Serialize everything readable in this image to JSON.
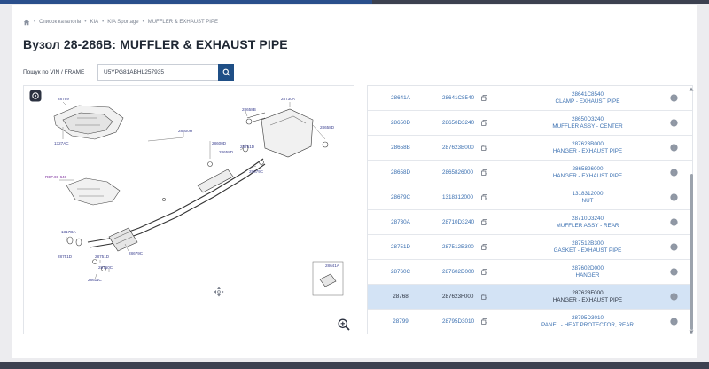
{
  "breadcrumb": {
    "items": [
      "Список каталогів",
      "KIA",
      "KIA Sportage",
      "MUFFLER & EXHAUST PIPE"
    ]
  },
  "page": {
    "title": "Вузол 28-286B: MUFFLER & EXHAUST PIPE"
  },
  "search": {
    "label": "Пошук по VIN / FRAME",
    "value": "U5YPG81ABHL257935"
  },
  "diagram": {
    "labels": {
      "l28799": "28799",
      "l1327AC": "1327AC",
      "l28600H": "28600H",
      "l28730A": "28730A",
      "l28658B": "28658B",
      "l28658D": "28658D",
      "l28600D": "28600D",
      "l28658D_2": "28658D",
      "l28751D_top": "28751D",
      "l28679C": "28679C",
      "lREF": "REF.69-640",
      "l1317DA": "1317DA",
      "l28751D_low": "28751D",
      "l28751D_mid": "28751D",
      "l28760C": "28760C",
      "l28679C_low": "28679C",
      "l28611C": "28611C",
      "l28641A": "28641A"
    }
  },
  "parts": {
    "rows": [
      {
        "ref": "28641A",
        "part": "28641C8540",
        "number": "28641C8540",
        "name": "CLAMP - EXHAUST PIPE",
        "selected": false
      },
      {
        "ref": "28650D",
        "part": "28650D3240",
        "number": "28650D3240",
        "name": "MUFFLER ASSY - CENTER",
        "selected": false
      },
      {
        "ref": "28658B",
        "part": "287623B000",
        "number": "287623B000",
        "name": "HANGER - EXHAUST PIPE",
        "selected": false
      },
      {
        "ref": "28658D",
        "part": "2865826000",
        "number": "2865826000",
        "name": "HANGER - EXHAUST PIPE",
        "selected": false
      },
      {
        "ref": "28679C",
        "part": "1318312000",
        "number": "1318312000",
        "name": "NUT",
        "selected": false
      },
      {
        "ref": "28730A",
        "part": "28710D3240",
        "number": "28710D3240",
        "name": "MUFFLER ASSY - REAR",
        "selected": false
      },
      {
        "ref": "28751D",
        "part": "287512B300",
        "number": "287512B300",
        "name": "GASKET - EXHAUST PIPE",
        "selected": false
      },
      {
        "ref": "28760C",
        "part": "287602D000",
        "number": "287602D000",
        "name": "HANGER",
        "selected": false
      },
      {
        "ref": "28768",
        "part": "287623F000",
        "number": "287623F000",
        "name": "HANGER - EXHAUST PIPE",
        "selected": true
      },
      {
        "ref": "28799",
        "part": "28795D3010",
        "number": "28795D3010",
        "name": "PANEL - HEAT PROTECTOR, REAR",
        "selected": false
      }
    ]
  },
  "colors": {
    "accent": "#1f4f86",
    "link": "#3a6fb0",
    "selected_row": "#d3e3f5"
  },
  "icons": {
    "home": "home-icon",
    "search": "search-icon",
    "copy": "copy-icon",
    "info": "info-icon",
    "zoom": "zoom-in-icon",
    "move": "move-icon",
    "diagram_tool": "target-icon"
  }
}
